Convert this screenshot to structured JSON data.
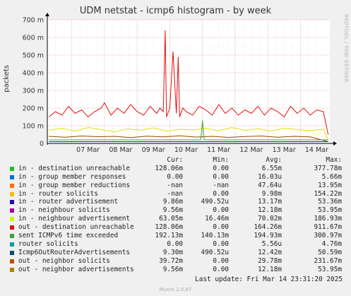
{
  "title": "UDM netstat - icmp6 histogram - by week",
  "side_label": "RRDTOOL / TOBI OETIKER",
  "ylabel": "packets",
  "colors": {
    "background": "#f0f0f0",
    "plot_bg": "#ffffff",
    "grid_major": "#e8b0b0",
    "grid_minor": "#f2dede",
    "axis": "#000000"
  },
  "chart_data": {
    "type": "line",
    "ylabel": "packets",
    "ylim": [
      0,
      0.7
    ],
    "y_ticks": [
      {
        "value": 0,
        "label": "0"
      },
      {
        "value": 0.1,
        "label": "100 m"
      },
      {
        "value": 0.2,
        "label": "200 m"
      },
      {
        "value": 0.3,
        "label": "300 m"
      },
      {
        "value": 0.4,
        "label": "400 m"
      },
      {
        "value": 0.5,
        "label": "500 m"
      },
      {
        "value": 0.6,
        "label": "600 m"
      },
      {
        "value": 0.7,
        "label": "700 m"
      }
    ],
    "xlim": [
      6.25,
      14.9
    ],
    "x_ticks": [
      {
        "value": 7,
        "label": "07 Mar"
      },
      {
        "value": 8,
        "label": "08 Mar"
      },
      {
        "value": 9,
        "label": "09 Mar"
      },
      {
        "value": 10,
        "label": "10 Mar"
      },
      {
        "value": 11,
        "label": "11 Mar"
      },
      {
        "value": 12,
        "label": "12 Mar"
      },
      {
        "value": 13,
        "label": "13 Mar"
      },
      {
        "value": 14,
        "label": "14 Mar"
      }
    ],
    "grid": true,
    "series": [
      {
        "name": "out - destination unreachable",
        "color": "#e01010",
        "x": [
          6.3,
          6.5,
          6.7,
          6.9,
          7.1,
          7.3,
          7.5,
          7.7,
          7.9,
          8.0,
          8.2,
          8.4,
          8.6,
          8.8,
          9.0,
          9.2,
          9.4,
          9.6,
          9.7,
          9.8,
          9.86,
          9.9,
          10.0,
          10.1,
          10.2,
          10.26,
          10.3,
          10.4,
          10.5,
          10.7,
          10.9,
          11.1,
          11.3,
          11.5,
          11.7,
          11.9,
          12.1,
          12.3,
          12.5,
          12.7,
          12.9,
          13.1,
          13.3,
          13.5,
          13.7,
          13.9,
          14.1,
          14.3,
          14.5,
          14.7,
          14.85
        ],
        "values": [
          0.15,
          0.18,
          0.16,
          0.21,
          0.17,
          0.19,
          0.15,
          0.18,
          0.2,
          0.23,
          0.16,
          0.2,
          0.17,
          0.22,
          0.18,
          0.16,
          0.21,
          0.17,
          0.2,
          0.18,
          0.64,
          0.15,
          0.2,
          0.52,
          0.17,
          0.49,
          0.15,
          0.2,
          0.18,
          0.16,
          0.21,
          0.19,
          0.16,
          0.22,
          0.17,
          0.2,
          0.16,
          0.19,
          0.17,
          0.21,
          0.16,
          0.2,
          0.18,
          0.15,
          0.21,
          0.17,
          0.2,
          0.16,
          0.19,
          0.18,
          0.05
        ]
      },
      {
        "name": "in - neighbour advertisement",
        "color": "#e0e000",
        "x": [
          6.3,
          6.7,
          7.1,
          7.5,
          7.9,
          8.3,
          8.7,
          9.1,
          9.5,
          9.9,
          10.3,
          10.7,
          11.1,
          11.5,
          11.9,
          12.3,
          12.7,
          13.1,
          13.5,
          13.9,
          14.3,
          14.7,
          14.85
        ],
        "values": [
          0.075,
          0.085,
          0.07,
          0.09,
          0.078,
          0.065,
          0.082,
          0.075,
          0.088,
          0.07,
          0.08,
          0.076,
          0.085,
          0.072,
          0.09,
          0.074,
          0.083,
          0.07,
          0.086,
          0.078,
          0.073,
          0.08,
          0.02
        ]
      },
      {
        "name": "out - neighbor solicits",
        "color": "#8c4b00",
        "x": [
          6.3,
          6.8,
          7.3,
          7.8,
          8.3,
          8.8,
          9.3,
          9.8,
          10.3,
          10.8,
          11.3,
          11.8,
          12.3,
          12.8,
          13.3,
          13.8,
          14.3,
          14.85
        ],
        "values": [
          0.04,
          0.035,
          0.042,
          0.038,
          0.04,
          0.033,
          0.041,
          0.037,
          0.043,
          0.036,
          0.04,
          0.034,
          0.039,
          0.042,
          0.035,
          0.04,
          0.037,
          0.01
        ]
      },
      {
        "name": "sent ICMPv6 time exceeded",
        "color": "#40a040",
        "x": [
          6.3,
          7.3,
          8.3,
          9.3,
          10.3,
          10.95,
          11.0,
          11.05,
          11.3,
          12.3,
          13.3,
          14.3,
          14.85
        ],
        "values": [
          0.02,
          0.02,
          0.02,
          0.02,
          0.02,
          0.02,
          0.13,
          0.02,
          0.02,
          0.02,
          0.02,
          0.02,
          0.02
        ]
      },
      {
        "name": "Icmp6OutRouterAdvertisements",
        "color": "#005070",
        "x": [
          6.3,
          8.3,
          10.3,
          12.3,
          14.85
        ],
        "values": [
          0.01,
          0.01,
          0.01,
          0.01,
          0.01
        ]
      }
    ]
  },
  "legend": {
    "headers": {
      "cur": "Cur:",
      "min": "Min:",
      "avg": "Avg:",
      "max": "Max:"
    },
    "rows": [
      {
        "color": "#20c020",
        "name": "in - destination unreachable",
        "cur": "128.06m",
        "min": "0.00",
        "avg": "6.55m",
        "max": "377.78m"
      },
      {
        "color": "#0070d0",
        "name": "in - group member responses",
        "cur": "0.00",
        "min": "0.00",
        "avg": "16.03u",
        "max": "5.66m"
      },
      {
        "color": "#ff7000",
        "name": "in - group member reductions",
        "cur": "-nan",
        "min": "-nan",
        "avg": "47.64u",
        "max": "13.95m"
      },
      {
        "color": "#f0c000",
        "name": "in - router solicits",
        "cur": "-nan",
        "min": "0.00",
        "avg": "9.98m",
        "max": "154.22m"
      },
      {
        "color": "#2010a0",
        "name": "in - router advertisement",
        "cur": "9.86m",
        "min": "490.52u",
        "avg": "13.17m",
        "max": "53.36m"
      },
      {
        "color": "#a000a0",
        "name": "in - neighbour solicits",
        "cur": "9.56m",
        "min": "0.00",
        "avg": "12.18m",
        "max": "53.95m"
      },
      {
        "color": "#d0f000",
        "name": "in - neighbour advertisement",
        "cur": "63.05m",
        "min": "16.46m",
        "avg": "70.02m",
        "max": "186.93m"
      },
      {
        "color": "#e01010",
        "name": "out - destination unreachable",
        "cur": "128.06m",
        "min": "0.00",
        "avg": "164.26m",
        "max": "911.67m"
      },
      {
        "color": "#40a040",
        "name": "sent ICMPv6 time exceeded",
        "cur": "192.13m",
        "min": "140.13m",
        "avg": "194.93m",
        "max": "300.97m"
      },
      {
        "color": "#00a0a0",
        "name": "router solicits",
        "cur": "0.00",
        "min": "0.00",
        "avg": "5.56u",
        "max": "4.76m"
      },
      {
        "color": "#005070",
        "name": "Icmp6OutRouterAdvertisements",
        "cur": "9.30m",
        "min": "490.52u",
        "avg": "12.42m",
        "max": "50.59m"
      },
      {
        "color": "#c05000",
        "name": "out - neighbor solicits",
        "cur": "39.72m",
        "min": "0.00",
        "avg": "29.78m",
        "max": "231.67m"
      },
      {
        "color": "#b08000",
        "name": "out - neighbor advertisements",
        "cur": "9.56m",
        "min": "0.00",
        "avg": "12.18m",
        "max": "53.95m"
      }
    ]
  },
  "last_update": "Last update: Fri Mar 14 23:31:20 2025",
  "munin_version": "Munin 2.0.67"
}
